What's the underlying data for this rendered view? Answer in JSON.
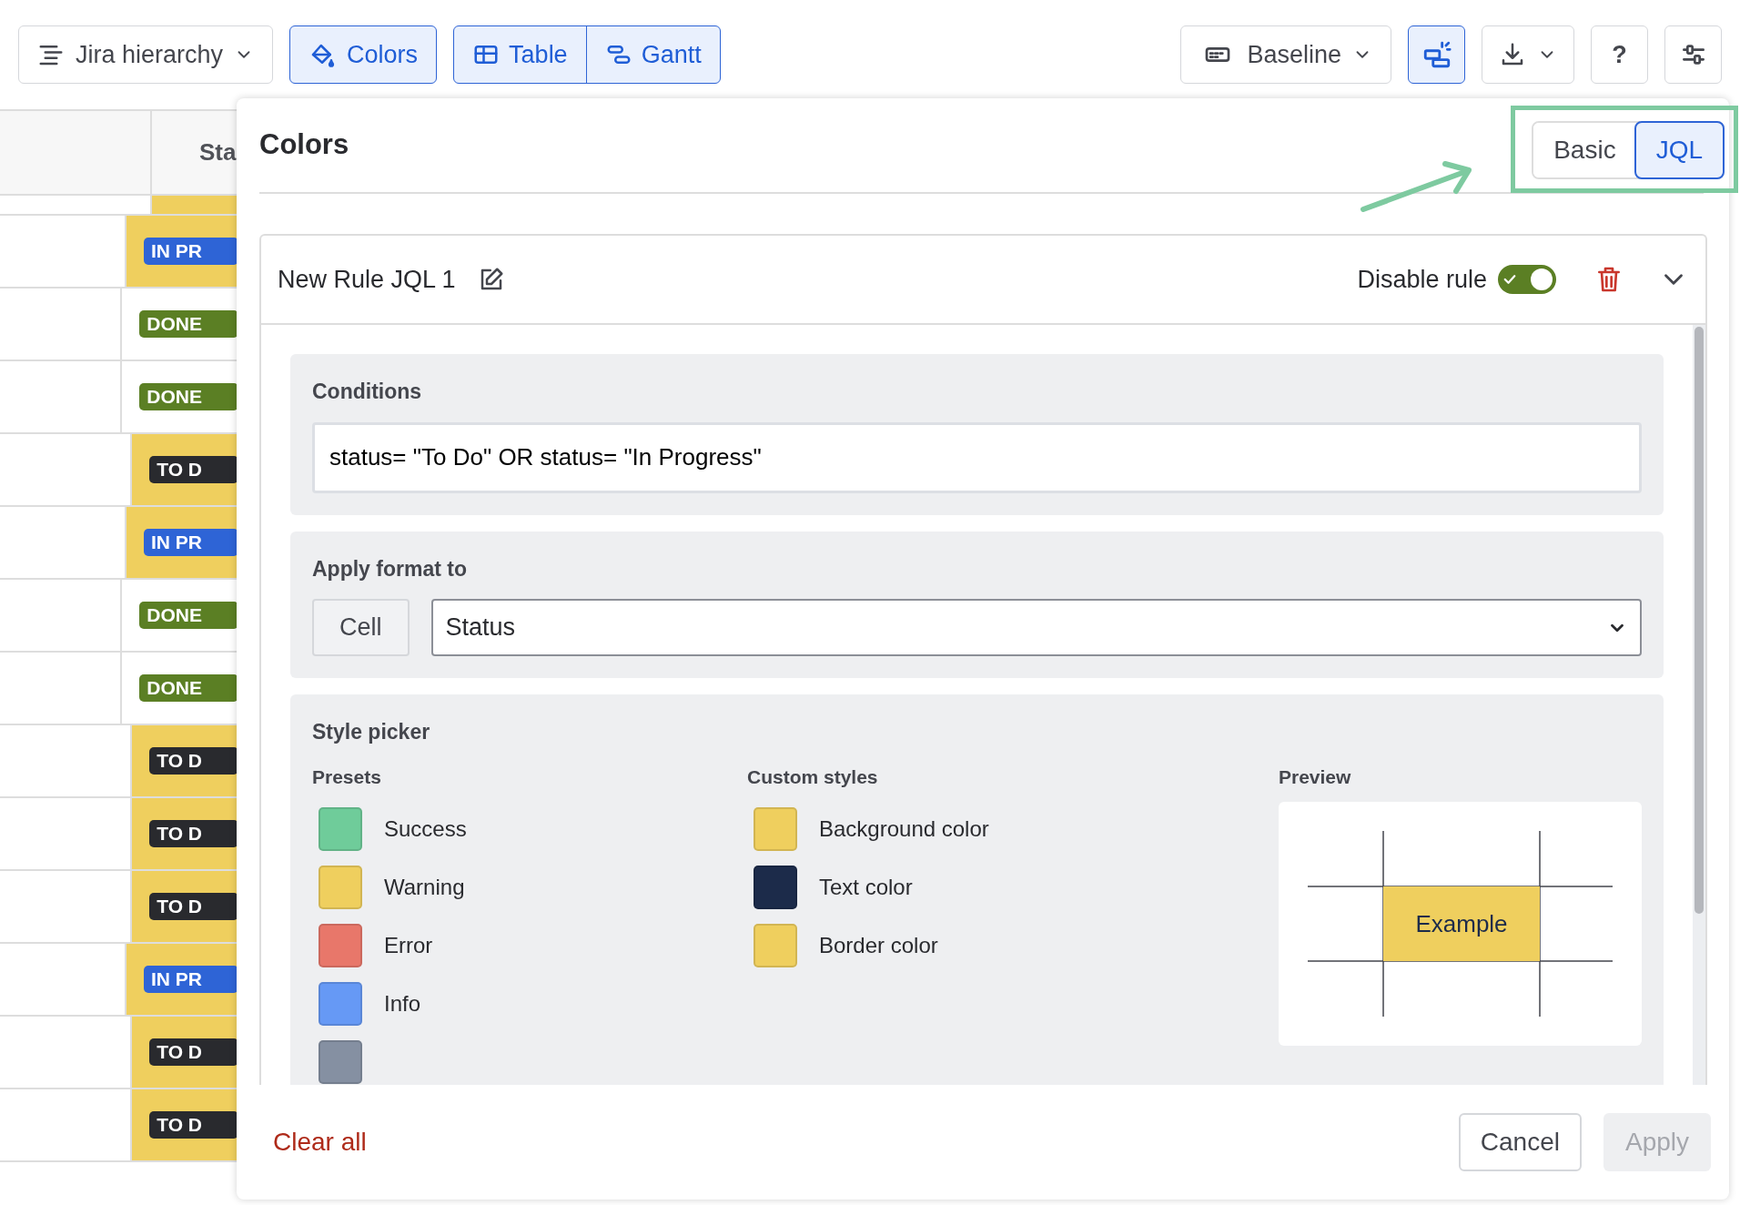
{
  "toolbar": {
    "hierarchy": {
      "label": "Jira hierarchy"
    },
    "colors": {
      "label": "Colors",
      "selected": true
    },
    "views": [
      {
        "label": "Table",
        "kind": "table"
      },
      {
        "label": "Gantt",
        "kind": "gantt"
      }
    ],
    "baseline": {
      "label": "Baseline"
    },
    "layout_toggle": {
      "selected": true
    },
    "help": {
      "label": "?"
    }
  },
  "table": {
    "status_header": "Sta",
    "rows": [
      {
        "status": "IN PR",
        "kind": "in_progress",
        "highlighted": true
      },
      {
        "status": "DONE",
        "kind": "done",
        "highlighted": false
      },
      {
        "status": "DONE",
        "kind": "done",
        "highlighted": false
      },
      {
        "status": "TO D",
        "kind": "todo",
        "highlighted": true
      },
      {
        "status": "IN PR",
        "kind": "in_progress",
        "highlighted": true
      },
      {
        "status": "DONE",
        "kind": "done",
        "highlighted": false
      },
      {
        "status": "DONE",
        "kind": "done",
        "highlighted": false
      },
      {
        "status": "TO D",
        "kind": "todo",
        "highlighted": true
      },
      {
        "status": "TO D",
        "kind": "todo",
        "highlighted": true
      },
      {
        "status": "TO D",
        "kind": "todo",
        "highlighted": true
      },
      {
        "status": "IN PR",
        "kind": "in_progress",
        "highlighted": true
      },
      {
        "status": "TO D",
        "kind": "todo",
        "highlighted": true
      },
      {
        "status": "TO D",
        "kind": "todo",
        "highlighted": true
      }
    ]
  },
  "panel": {
    "title": "Colors",
    "modes": [
      {
        "label": "Basic",
        "selected": false
      },
      {
        "label": "JQL",
        "selected": true
      }
    ],
    "rule": {
      "name": "New Rule JQL 1",
      "disable_label": "Disable rule",
      "on": true
    },
    "conditions": {
      "label": "Conditions",
      "value": "status= \"To Do\" OR status= \"In Progress\""
    },
    "apply_format": {
      "label": "Apply format to",
      "scope": "Cell",
      "target": "Status"
    },
    "style_picker": {
      "title": "Style picker",
      "presets_label": "Presets",
      "custom_label": "Custom styles",
      "preview_label": "Preview",
      "preview_text": "Example",
      "presets": [
        {
          "label": "Success",
          "color": "#6fcc9a"
        },
        {
          "label": "Warning",
          "color": "#efcf5e"
        },
        {
          "label": "Error",
          "color": "#e8776a"
        },
        {
          "label": "Info",
          "color": "#6699f5"
        },
        {
          "color": "#8590a2"
        }
      ],
      "custom": [
        {
          "label": "Background color",
          "color": "#efcf5e"
        },
        {
          "label": "Text color",
          "color": "#1c2b4a"
        },
        {
          "label": "Border color",
          "color": "#efcf5e"
        }
      ]
    },
    "footer": {
      "clear": "Clear all",
      "cancel": "Cancel",
      "apply": {
        "label": "Apply",
        "disabled": true
      }
    }
  }
}
